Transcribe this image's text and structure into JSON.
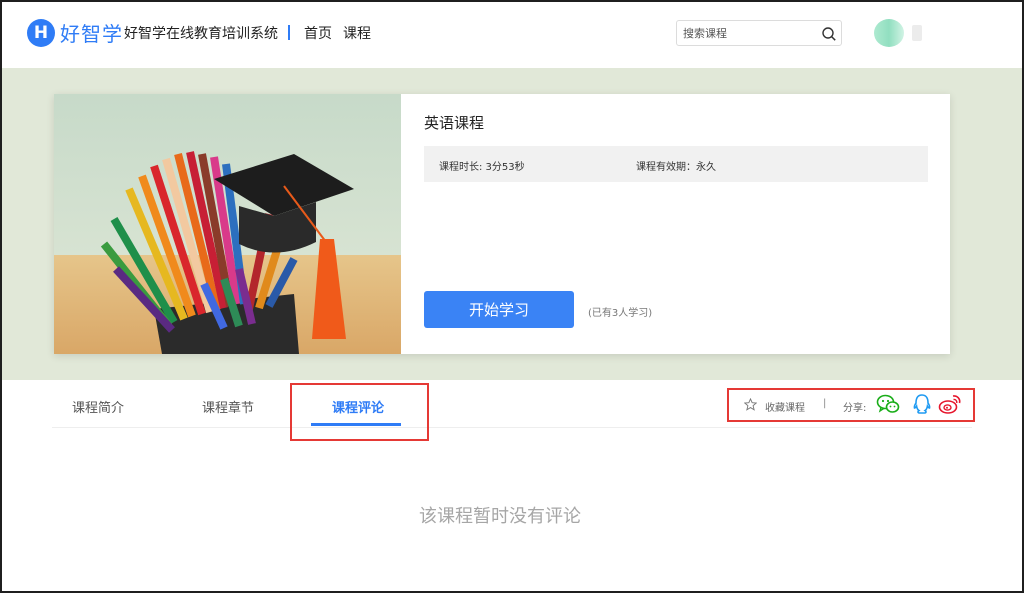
{
  "header": {
    "logo_letter": "H",
    "brand": "好智学",
    "system_title": "好智学在线教育培训系统",
    "nav": {
      "home": "首页",
      "courses": "课程"
    },
    "search": {
      "placeholder": "搜索课程",
      "value": ""
    }
  },
  "course": {
    "name": "英语课程",
    "duration_text": "课程时长: 3分53秒",
    "validity_text": "课程有效期：永久",
    "start_button": "开始学习",
    "learner_count": "(已有3人学习)"
  },
  "tabs": [
    {
      "label": "课程简介",
      "active": false
    },
    {
      "label": "课程章节",
      "active": false
    },
    {
      "label": "课程评论",
      "active": true
    }
  ],
  "actions": {
    "favorite_label": "收藏课程",
    "separator": "|",
    "share_label": "分享:",
    "share_targets": [
      "wechat-icon",
      "qq-icon",
      "weibo-icon"
    ]
  },
  "comments": {
    "empty_text": "该课程暂时没有评论"
  },
  "colors": {
    "accent": "#2f7cf6",
    "banner_bg": "#e1e8d8",
    "highlight": "#e53935",
    "wechat": "#1aad19",
    "qq": "#1e9af2",
    "weibo": "#e6162d"
  }
}
